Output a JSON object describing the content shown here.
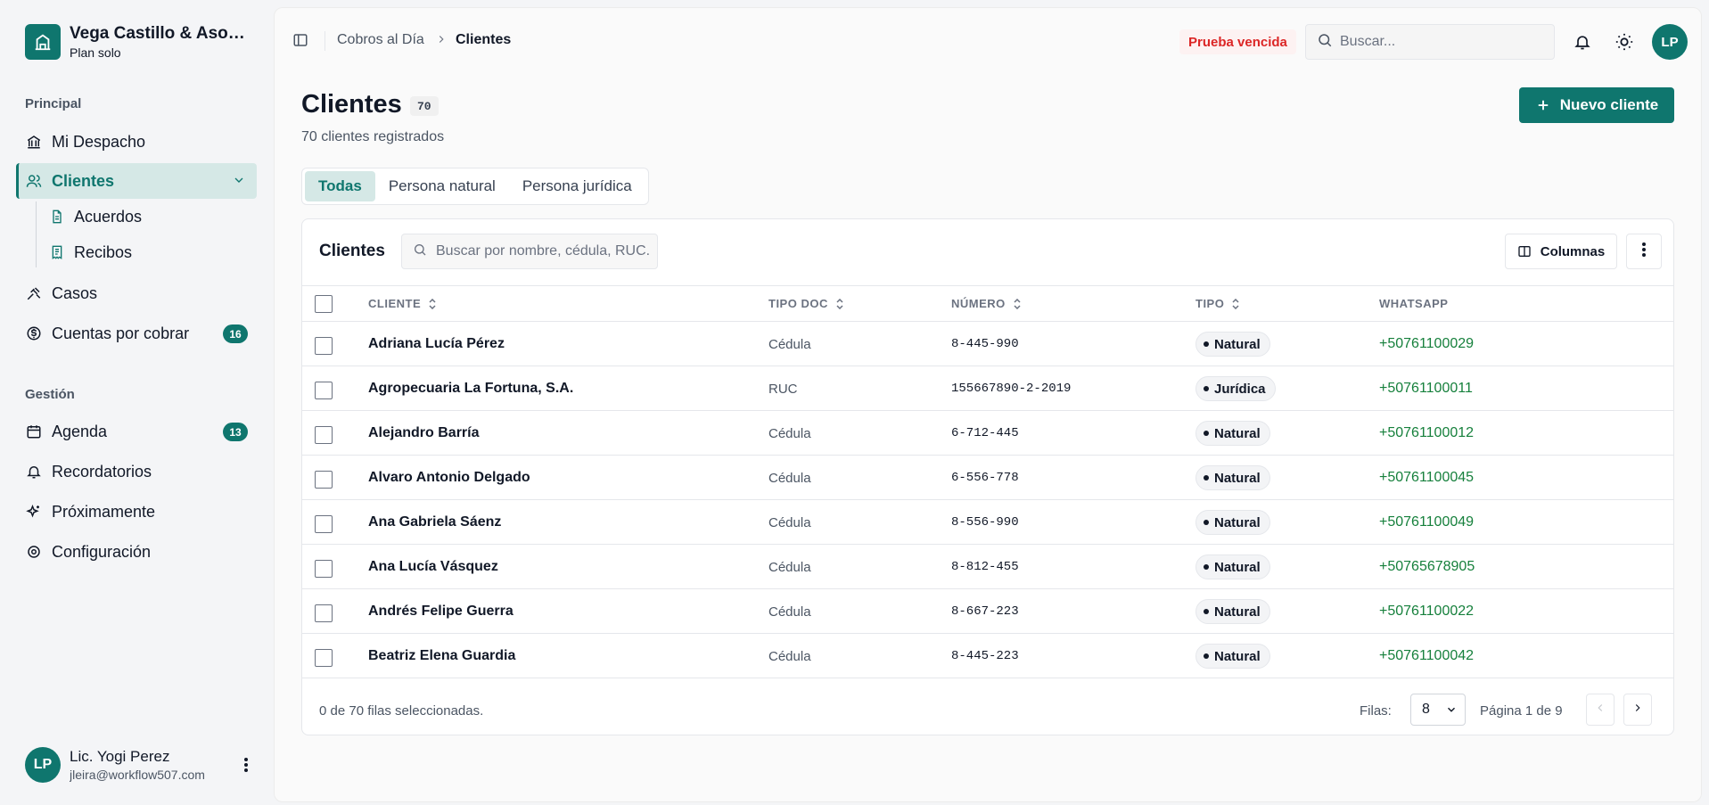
{
  "brand": {
    "name": "Vega Castillo & Asociados",
    "plan": "Plan solo"
  },
  "sidebar": {
    "section_principal": "Principal",
    "section_gestion": "Gestión",
    "items": {
      "mi_despacho": "Mi Despacho",
      "clientes": "Clientes",
      "acuerdos": "Acuerdos",
      "recibos": "Recibos",
      "casos": "Casos",
      "cuentas": "Cuentas por cobrar",
      "cuentas_badge": "16",
      "agenda": "Agenda",
      "agenda_badge": "13",
      "recordatorios": "Recordatorios",
      "proximamente": "Próximamente",
      "configuracion": "Configuración"
    },
    "user": {
      "initials": "LP",
      "name": "Lic. Yogi Perez",
      "email": "jleira@workflow507.com"
    }
  },
  "topbar": {
    "breadcrumb_parent": "Cobros al Día",
    "breadcrumb_current": "Clientes",
    "trial_badge": "Prueba vencida",
    "search_placeholder": "Buscar...",
    "avatar_initials": "LP"
  },
  "page": {
    "title": "Clientes",
    "count": "70",
    "subtitle": "70 clientes registrados",
    "new_button": "Nuevo cliente",
    "tabs": [
      "Todas",
      "Persona natural",
      "Persona jurídica"
    ]
  },
  "table": {
    "title": "Clientes",
    "search_placeholder": "Buscar por nombre, cédula, RUC...",
    "columns_button": "Columnas",
    "headers": {
      "cliente": "CLIENTE",
      "tipo_doc": "TIPO DOC",
      "numero": "NÚMERO",
      "tipo": "TIPO",
      "whatsapp": "WHATSAPP"
    },
    "rows": [
      {
        "name": "Adriana Lucía Pérez",
        "doc": "Cédula",
        "num": "8-445-990",
        "tipo": "Natural",
        "wa": "+50761100029"
      },
      {
        "name": "Agropecuaria La Fortuna, S.A.",
        "doc": "RUC",
        "num": "155667890-2-2019",
        "tipo": "Jurídica",
        "wa": "+50761100011"
      },
      {
        "name": "Alejandro Barría",
        "doc": "Cédula",
        "num": "6-712-445",
        "tipo": "Natural",
        "wa": "+50761100012"
      },
      {
        "name": "Alvaro Antonio Delgado",
        "doc": "Cédula",
        "num": "6-556-778",
        "tipo": "Natural",
        "wa": "+50761100045"
      },
      {
        "name": "Ana Gabriela Sáenz",
        "doc": "Cédula",
        "num": "8-556-990",
        "tipo": "Natural",
        "wa": "+50761100049"
      },
      {
        "name": "Ana Lucía Vásquez",
        "doc": "Cédula",
        "num": "8-812-455",
        "tipo": "Natural",
        "wa": "+50765678905"
      },
      {
        "name": "Andrés Felipe Guerra",
        "doc": "Cédula",
        "num": "8-667-223",
        "tipo": "Natural",
        "wa": "+50761100022"
      },
      {
        "name": "Beatriz Elena Guardia",
        "doc": "Cédula",
        "num": "8-445-223",
        "tipo": "Natural",
        "wa": "+50761100042"
      }
    ],
    "footer": {
      "selected": "0 de 70 filas seleccionadas.",
      "rows_label": "Filas:",
      "rows_value": "8",
      "page_label": "Página 1 de 9"
    }
  },
  "colors": {
    "accent": "#0f766e",
    "whatsapp": "#16803c",
    "trial": "#dc2626"
  }
}
